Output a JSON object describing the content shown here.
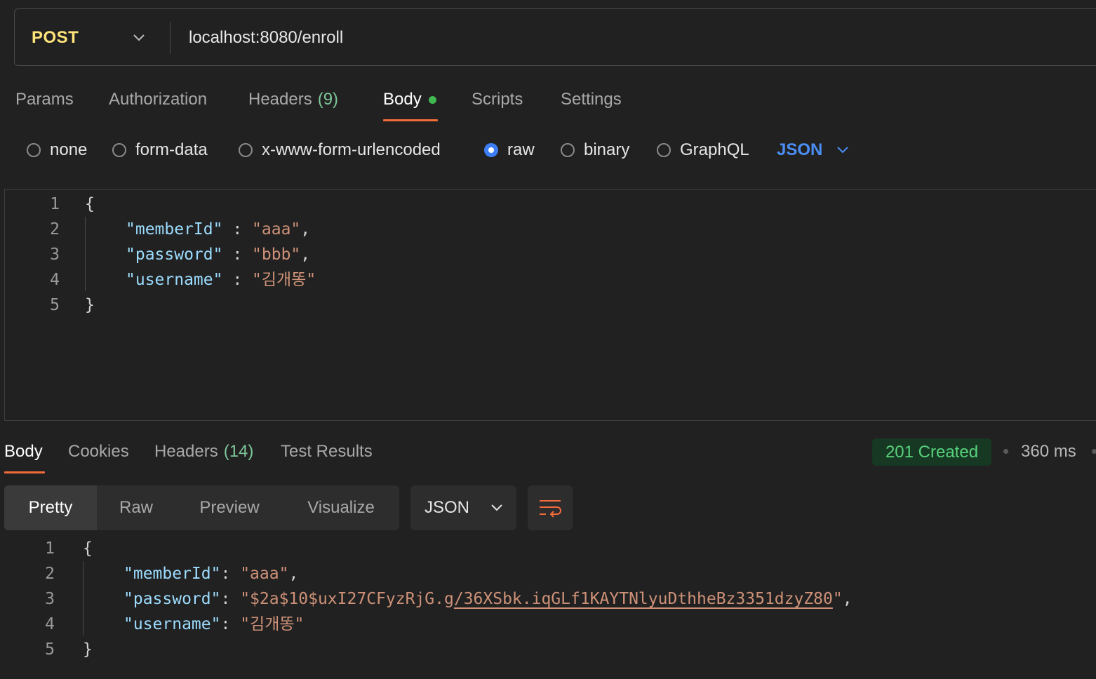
{
  "request": {
    "method": "POST",
    "url": "localhost:8080/enroll"
  },
  "request_tabs": {
    "params": "Params",
    "authorization": "Authorization",
    "headers": "Headers",
    "headers_count": "(9)",
    "body": "Body",
    "scripts": "Scripts",
    "settings": "Settings",
    "active": "Body"
  },
  "body_types": {
    "none": "none",
    "form_data": "form-data",
    "urlencoded": "x-www-form-urlencoded",
    "raw": "raw",
    "binary": "binary",
    "graphql": "GraphQL",
    "selected": "raw",
    "language": "JSON"
  },
  "request_body": {
    "line_numbers": [
      "1",
      "2",
      "3",
      "4",
      "5"
    ],
    "open": "{",
    "close": "}",
    "member_key": "\"memberId\"",
    "member_val": "\"aaa\"",
    "password_key": "\"password\"",
    "password_val": "\"bbb\"",
    "username_key": "\"username\"",
    "username_val": "\"김개똥\"",
    "colon": " : ",
    "comma": ","
  },
  "response_tabs": {
    "body": "Body",
    "cookies": "Cookies",
    "headers": "Headers",
    "headers_count": "(14)",
    "test_results": "Test Results",
    "active": "Body"
  },
  "response_status": {
    "status": "201 Created",
    "time": "360 ms",
    "status_color": "#57d27c"
  },
  "view_modes": {
    "pretty": "Pretty",
    "raw": "Raw",
    "preview": "Preview",
    "visualize": "Visualize",
    "selected": "Pretty",
    "format": "JSON"
  },
  "response_body": {
    "line_numbers": [
      "1",
      "2",
      "3",
      "4",
      "5"
    ],
    "open": "{",
    "close": "}",
    "member_key": "\"memberId\"",
    "member_val": "\"aaa\"",
    "password_key": "\"password\"",
    "password_val_plain": "\"$2a$10$uxI27CFyzRjG.g",
    "password_val_link": "/36XSbk.iqGLf1KAYTNlyuDthheBz3351dzyZ80",
    "password_val_end": "\"",
    "username_key": "\"username\"",
    "username_val": "\"김개똥\"",
    "colon": ": ",
    "comma": ","
  },
  "icons": {
    "method_dropdown": "chevron-down-icon",
    "language_dropdown": "chevron-down-icon",
    "format_dropdown": "chevron-down-icon",
    "wrap": "wrap-lines-icon"
  },
  "colors": {
    "method": "#ffe47a",
    "accent_tab": "#f26b3a",
    "link_blue": "#4b8ff5",
    "json_key": "#9cdcfe",
    "json_string": "#ce9178"
  }
}
